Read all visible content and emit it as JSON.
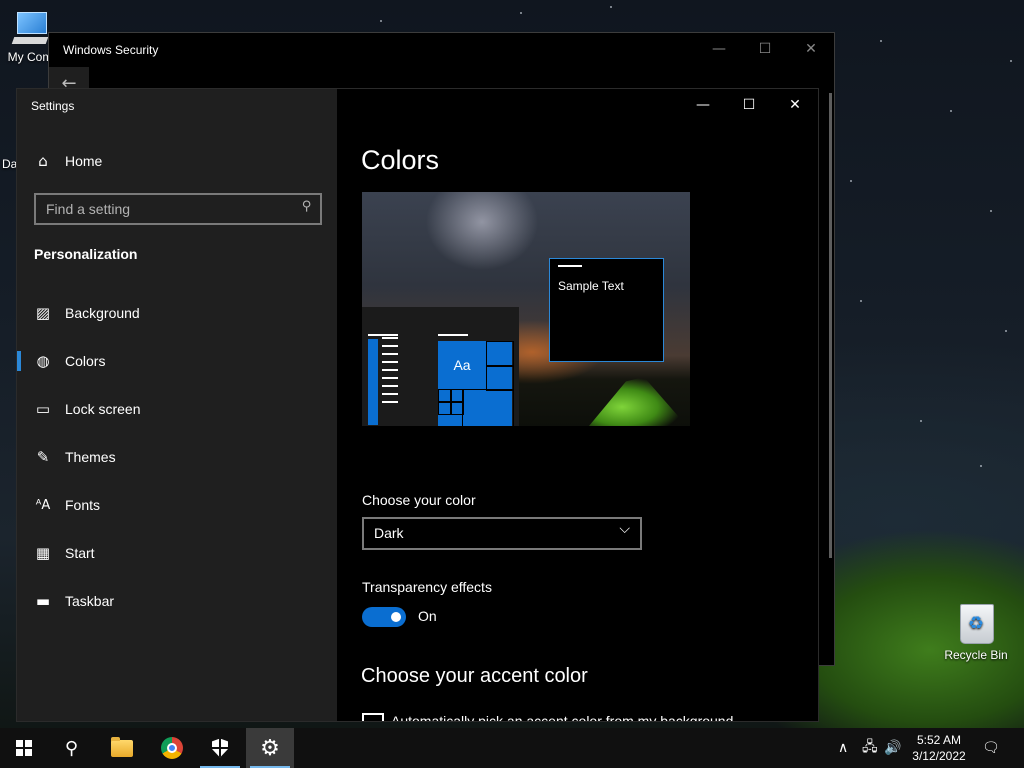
{
  "desktop": {
    "icons": [
      {
        "label": "My Com"
      },
      {
        "label": "Da"
      },
      {
        "label": "Recycle Bin"
      }
    ]
  },
  "security_window": {
    "title": "Windows Security",
    "back_glyph": "←",
    "controls": {
      "minimize": "—",
      "maximize": "☐",
      "close": "✕"
    }
  },
  "settings": {
    "app_title": "Settings",
    "controls": {
      "minimize": "—",
      "maximize": "☐",
      "close": "✕"
    },
    "home": {
      "label": "Home",
      "icon": "home-icon"
    },
    "search": {
      "placeholder": "Find a setting",
      "icon": "search-icon"
    },
    "section": "Personalization",
    "nav": [
      {
        "label": "Background",
        "icon": "picture-icon",
        "glyph": "🖼"
      },
      {
        "label": "Colors",
        "icon": "palette-icon",
        "glyph": "🎨",
        "active": true
      },
      {
        "label": "Lock screen",
        "icon": "lock-screen-icon",
        "glyph": "▭"
      },
      {
        "label": "Themes",
        "icon": "brush-icon",
        "glyph": "🖌"
      },
      {
        "label": "Fonts",
        "icon": "fonts-icon",
        "glyph": "ᴬA"
      },
      {
        "label": "Start",
        "icon": "start-tiles-icon",
        "glyph": "▦"
      },
      {
        "label": "Taskbar",
        "icon": "taskbar-icon",
        "glyph": "▬"
      }
    ],
    "main": {
      "title": "Colors",
      "preview": {
        "tile_label": "Aa",
        "sample_text": "Sample Text"
      },
      "choose_color_label": "Choose your color",
      "choose_color_value": "Dark",
      "transparency_label": "Transparency effects",
      "transparency_state": "On",
      "accent_heading": "Choose your accent color",
      "auto_pick_label": "Automatically pick an accent color from my background"
    },
    "colors": {
      "accent": "#0a6ed1",
      "sidebar": "#1f1f1f",
      "content": "#000000"
    }
  },
  "taskbar": {
    "apps": [
      {
        "name": "start",
        "icon": "windows-logo-icon"
      },
      {
        "name": "search",
        "icon": "search-icon",
        "glyph": "⚲"
      },
      {
        "name": "file-explorer",
        "icon": "folder-icon"
      },
      {
        "name": "chrome",
        "icon": "chrome-icon"
      },
      {
        "name": "windows-security",
        "icon": "shield-icon",
        "running": true
      },
      {
        "name": "settings",
        "icon": "gear-icon",
        "glyph": "⚙",
        "active": true
      }
    ],
    "tray": {
      "chevron": "∧",
      "network": "🖧",
      "volume": "🔊",
      "notifications": "🗨"
    },
    "clock": {
      "time": "5:52 AM",
      "date": "3/12/2022"
    }
  }
}
